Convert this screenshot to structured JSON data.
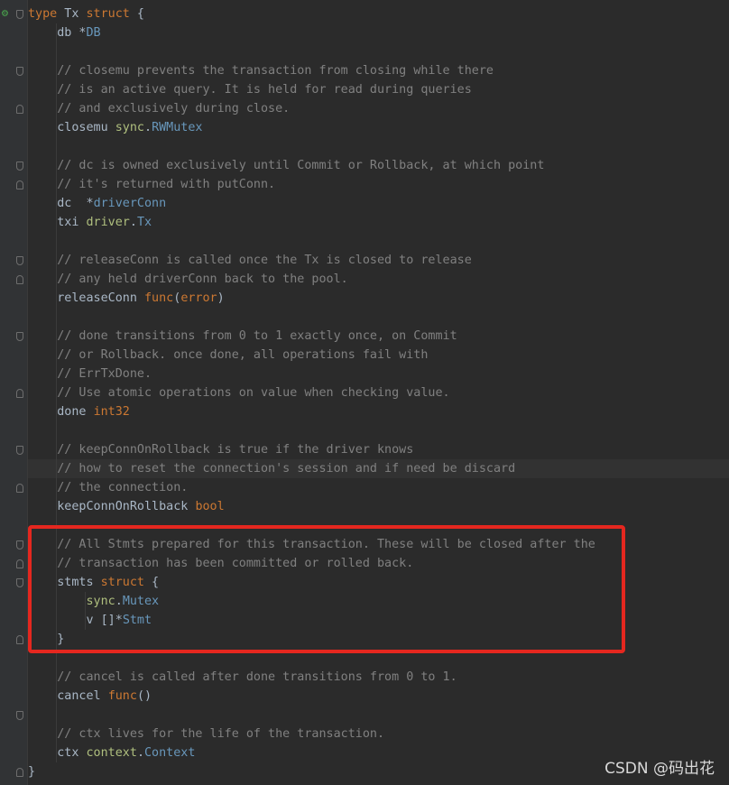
{
  "colors": {
    "background": "#2b2b2b",
    "gutter": "#313335",
    "keyword": "#cc7832",
    "type": "#6897bb",
    "package": "#afbf7e",
    "comment": "#808080",
    "plain": "#a9b7c6",
    "highlight_border": "#e5271f"
  },
  "gutter_icon": {
    "name": "implementation-marker-icon",
    "glyph": "⚙"
  },
  "lines": [
    [
      {
        "t": "keyword",
        "s": "type"
      },
      {
        "t": "plain",
        "s": " Tx "
      },
      {
        "t": "keyword",
        "s": "struct"
      },
      {
        "t": "plain",
        "s": " {"
      }
    ],
    [
      {
        "t": "plain",
        "s": "    db *"
      },
      {
        "t": "type",
        "s": "DB"
      }
    ],
    [],
    [
      {
        "t": "comment",
        "s": "    // closemu prevents the transaction from closing while there"
      }
    ],
    [
      {
        "t": "comment",
        "s": "    // is an active query. It is held for read during queries"
      }
    ],
    [
      {
        "t": "comment",
        "s": "    // and exclusively during close."
      }
    ],
    [
      {
        "t": "plain",
        "s": "    closemu "
      },
      {
        "t": "pkg",
        "s": "sync"
      },
      {
        "t": "plain",
        "s": "."
      },
      {
        "t": "type",
        "s": "RWMutex"
      }
    ],
    [],
    [
      {
        "t": "comment",
        "s": "    // dc is owned exclusively until Commit or Rollback, at which point"
      }
    ],
    [
      {
        "t": "comment",
        "s": "    // it's returned with putConn."
      }
    ],
    [
      {
        "t": "plain",
        "s": "    dc  *"
      },
      {
        "t": "type",
        "s": "driverConn"
      }
    ],
    [
      {
        "t": "plain",
        "s": "    txi "
      },
      {
        "t": "pkg",
        "s": "driver"
      },
      {
        "t": "plain",
        "s": "."
      },
      {
        "t": "type",
        "s": "Tx"
      }
    ],
    [],
    [
      {
        "t": "comment",
        "s": "    // releaseConn is called once the Tx is closed to release"
      }
    ],
    [
      {
        "t": "comment",
        "s": "    // any held driverConn back to the pool."
      }
    ],
    [
      {
        "t": "plain",
        "s": "    releaseConn "
      },
      {
        "t": "keyword",
        "s": "func"
      },
      {
        "t": "plain",
        "s": "("
      },
      {
        "t": "keyword",
        "s": "error"
      },
      {
        "t": "plain",
        "s": ")"
      }
    ],
    [],
    [
      {
        "t": "comment",
        "s": "    // done transitions from 0 to 1 exactly once, on Commit"
      }
    ],
    [
      {
        "t": "comment",
        "s": "    // or Rollback. once done, all operations fail with"
      }
    ],
    [
      {
        "t": "comment",
        "s": "    // ErrTxDone."
      }
    ],
    [
      {
        "t": "comment",
        "s": "    // Use atomic operations on value when checking value."
      }
    ],
    [
      {
        "t": "plain",
        "s": "    done "
      },
      {
        "t": "keyword",
        "s": "int32"
      }
    ],
    [],
    [
      {
        "t": "comment",
        "s": "    // keepConnOnRollback is true if the driver knows"
      }
    ],
    [
      {
        "t": "comment",
        "s": "    // how to reset the connection's session and if need be discard"
      }
    ],
    [
      {
        "t": "comment",
        "s": "    // the connection."
      }
    ],
    [
      {
        "t": "plain",
        "s": "    keepConnOnRollback "
      },
      {
        "t": "keyword",
        "s": "bool"
      }
    ],
    [],
    [
      {
        "t": "comment",
        "s": "    // All Stmts prepared for this transaction. These will be closed after the"
      }
    ],
    [
      {
        "t": "comment",
        "s": "    // transaction has been committed or rolled back."
      }
    ],
    [
      {
        "t": "plain",
        "s": "    stmts "
      },
      {
        "t": "keyword",
        "s": "struct"
      },
      {
        "t": "plain",
        "s": " {"
      }
    ],
    [
      {
        "t": "plain",
        "s": "        "
      },
      {
        "t": "pkg",
        "s": "sync"
      },
      {
        "t": "plain",
        "s": "."
      },
      {
        "t": "type",
        "s": "Mutex"
      }
    ],
    [
      {
        "t": "plain",
        "s": "        v []*"
      },
      {
        "t": "type",
        "s": "Stmt"
      }
    ],
    [
      {
        "t": "plain",
        "s": "    }"
      }
    ],
    [],
    [
      {
        "t": "comment",
        "s": "    // cancel is called after done transitions from 0 to 1."
      }
    ],
    [
      {
        "t": "plain",
        "s": "    cancel "
      },
      {
        "t": "keyword",
        "s": "func"
      },
      {
        "t": "plain",
        "s": "()"
      }
    ],
    [],
    [
      {
        "t": "comment",
        "s": "    // ctx lives for the life of the transaction."
      }
    ],
    [
      {
        "t": "plain",
        "s": "    ctx "
      },
      {
        "t": "pkg",
        "s": "context"
      },
      {
        "t": "plain",
        "s": "."
      },
      {
        "t": "type",
        "s": "Context"
      }
    ],
    [
      {
        "t": "plain",
        "s": "}"
      }
    ]
  ],
  "watermark": "CSDN @码出花"
}
